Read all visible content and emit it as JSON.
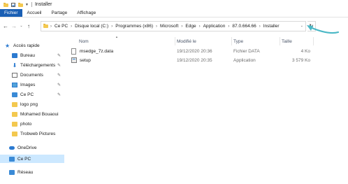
{
  "window": {
    "title": "Installer"
  },
  "ribbon": {
    "tabs": [
      "Fichier",
      "Accueil",
      "Partage",
      "Affichage"
    ]
  },
  "nav": {
    "back": "←",
    "forward": "→",
    "recent": "⌄",
    "up": "↑",
    "refresh": "↻"
  },
  "address": {
    "crumbs": [
      "Ce PC",
      "Disque local (C:)",
      "Programmes (x86)",
      "Microsoft",
      "Edge",
      "Application",
      "87.0.664.66",
      "Installer"
    ],
    "separator": "›",
    "dropdown": "⌄"
  },
  "sidebar": {
    "items": [
      {
        "label": "Accès rapide",
        "icon": "star-icon",
        "pinned": false
      },
      {
        "label": "Bureau",
        "icon": "desktop-icon",
        "pinned": true
      },
      {
        "label": "Téléchargements",
        "icon": "download-icon",
        "pinned": true
      },
      {
        "label": "Documents",
        "icon": "documents-icon",
        "pinned": true
      },
      {
        "label": "Images",
        "icon": "images-icon",
        "pinned": true
      },
      {
        "label": "Ce PC",
        "icon": "pc-icon",
        "pinned": true
      },
      {
        "label": "logo png",
        "icon": "folder-icon",
        "pinned": false
      },
      {
        "label": "Mohamed Bouaoui",
        "icon": "folder-icon",
        "pinned": false
      },
      {
        "label": "photo",
        "icon": "folder-icon",
        "pinned": false
      },
      {
        "label": "Trobweb Pictures",
        "icon": "folder-icon",
        "pinned": false
      },
      {
        "label": "OneDrive",
        "icon": "cloud-icon",
        "pinned": false
      },
      {
        "label": "Ce PC",
        "icon": "pc-icon",
        "pinned": false,
        "selected": true
      },
      {
        "label": "Réseau",
        "icon": "network-icon",
        "pinned": false
      }
    ],
    "pin_glyph": "✎"
  },
  "columns": {
    "name": "Nom",
    "modified": "Modifié le",
    "type": "Type",
    "size": "Taille"
  },
  "files": [
    {
      "name": "msedge_7z.data",
      "modified": "19/12/2020 20:36",
      "type": "Fichier DATA",
      "size": "4 Ko",
      "icon": "file-icon"
    },
    {
      "name": "setup",
      "modified": "19/12/2020 20:35",
      "type": "Application",
      "size": "3 579 Ko",
      "icon": "app-icon"
    }
  ],
  "colors": {
    "accent": "#1a5fb4",
    "selection": "#cce8ff",
    "annotation": "#4bb8c6"
  }
}
